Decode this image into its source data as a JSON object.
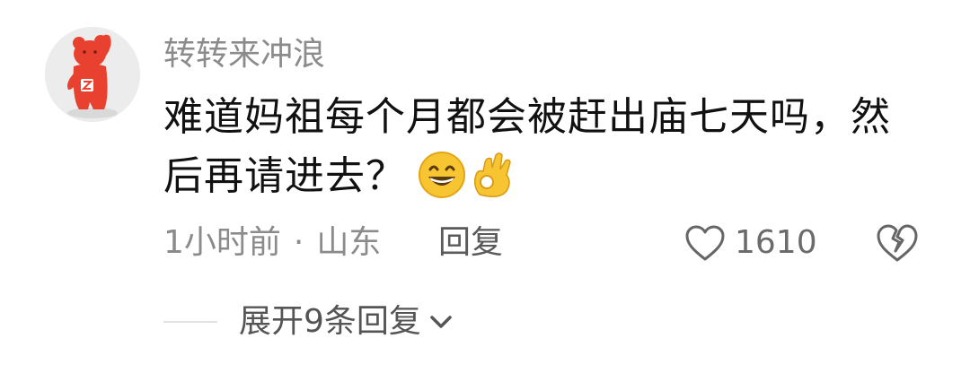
{
  "comment": {
    "username": "转转来冲浪",
    "text_line1": "难道妈祖每个月都会被赶出庙七天吗，然",
    "text_line2": "后再请进去？",
    "emojis": [
      "grinning-face-icon",
      "ok-hand-icon"
    ],
    "time": "1小时前",
    "separator": "·",
    "location": "山东",
    "reply_label": "回复",
    "like_count": "1610",
    "expand_replies_label": "展开9条回复"
  },
  "colors": {
    "avatar_bg": "#ececec",
    "avatar_figure": "#e8412f",
    "meta_text": "#8b8b8b",
    "body_text": "#111111",
    "emoji_yellow": "#f7c531"
  }
}
